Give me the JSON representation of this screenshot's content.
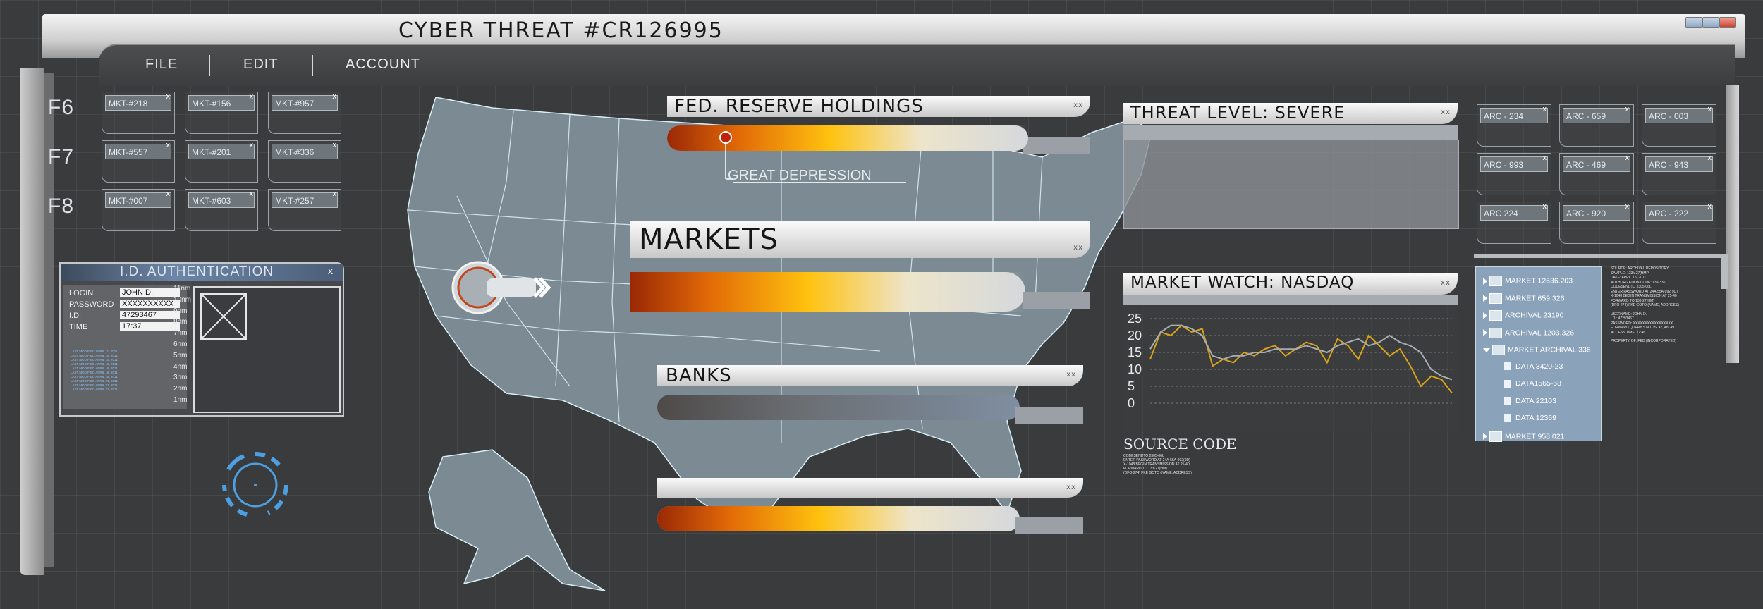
{
  "window": {
    "title": "CYBER THREAT #CR126995"
  },
  "menu": [
    {
      "label": "FILE"
    },
    {
      "label": "EDIT"
    },
    {
      "label": "ACCOUNT"
    }
  ],
  "fkeys": [
    "F6",
    "F7",
    "F8"
  ],
  "mkt_chips": [
    [
      "MKT-#218",
      "MKT-#156",
      "MKT-#957"
    ],
    [
      "MKT-#557",
      "MKT-#201",
      "MKT-#336"
    ],
    [
      "MKT-#007",
      "MKT-#603",
      "MKT-#257"
    ]
  ],
  "arc_chips": [
    [
      "ARC - 234",
      "ARC - 659",
      "ARC - 003"
    ],
    [
      "ARC - 993",
      "ARC - 469",
      "ARC - 943"
    ],
    [
      "ARC 224",
      "ARC - 920",
      "ARC - 222"
    ]
  ],
  "auth": {
    "title": "I.D. AUTHENTICATION",
    "fields": [
      {
        "label": "LOGIN",
        "value": "JOHN D."
      },
      {
        "label": "PASSWORD",
        "value": "XXXXXXXXXX"
      },
      {
        "label": "I.D.",
        "value": "47293467"
      },
      {
        "label": "TIME",
        "value": "17:37"
      }
    ],
    "log_lines": [
      "LAST MODIFIED APRIL 11, 2011",
      "LAST MODIFIED APRIL 14, 2011",
      "LAST MODIFIED APRIL 14, 2011",
      "LAST MODIFIED APRIL 15, 2011",
      "LAST MODIFIED APRIL 16, 2011",
      "LAST MODIFIED APRIL 16, 2011",
      "LAST MODIFIED APRIL 18, 2011",
      "LAST MODIFIED APRIL 21, 2011",
      "LAST MODIFIED APRIL 21, 2011",
      "LAST MODIFIED APRIL 22, 2011"
    ],
    "scale": [
      "11nm",
      "10nm",
      "9nm",
      "8nm",
      "7nm",
      "6nm",
      "5nm",
      "4nm",
      "3nm",
      "2nm",
      "1nm"
    ]
  },
  "fed": {
    "title": "FED. RESERVE HOLDINGS",
    "marker_label": "GREAT DEPRESSION",
    "level": 0.1
  },
  "markets": {
    "title": "MARKETS",
    "level": 0.55
  },
  "banks": {
    "title": "BANKS",
    "level": 1.0
  },
  "unnamed_panel": {
    "title": "",
    "level": 0.55
  },
  "threat": {
    "title": "THREAT LEVEL: SEVERE"
  },
  "market_watch": {
    "title": "MARKET WATCH: NASDAQ"
  },
  "chart_data": {
    "type": "line",
    "title": "MARKET WATCH: NASDAQ",
    "xlabel": "",
    "ylabel": "",
    "ylim": [
      0,
      25
    ],
    "yticks": [
      0,
      5,
      10,
      15,
      20,
      25
    ],
    "grid": true,
    "x": [
      0,
      1,
      2,
      3,
      4,
      5,
      6,
      7,
      8,
      9,
      10,
      11,
      12,
      13,
      14,
      15,
      16,
      17,
      18,
      19,
      20,
      21,
      22,
      23,
      24,
      25,
      26,
      27,
      28,
      29
    ],
    "series": [
      {
        "color": "#d9a21a",
        "values": [
          13,
          21,
          20,
          23,
          21,
          22,
          11,
          13,
          12,
          15,
          14,
          16,
          17,
          14,
          16,
          18,
          17,
          12,
          19,
          17,
          13,
          20,
          17,
          14,
          16,
          11,
          5,
          8,
          7,
          3
        ]
      },
      {
        "color": "#a6aeb4",
        "values": [
          16,
          21,
          23,
          23,
          22,
          20,
          14,
          13,
          14,
          14,
          15,
          15,
          16,
          16,
          16,
          17,
          16,
          15,
          17,
          18,
          19,
          17,
          18,
          20,
          18,
          17,
          15,
          10,
          8,
          7
        ]
      }
    ]
  },
  "tree": [
    {
      "label": "MARKET 12636.203",
      "type": "market",
      "expanded": false
    },
    {
      "label": "MARKET 659.326",
      "type": "market",
      "expanded": false
    },
    {
      "label": "ARCHIVAL 23190",
      "type": "market",
      "expanded": false
    },
    {
      "label": "ARCHIVAL 1203.326",
      "type": "market",
      "expanded": false
    },
    {
      "label": "MARKET ARCHIVAL 336",
      "type": "market",
      "expanded": true
    },
    {
      "label": "DATA 3420-23",
      "type": "data"
    },
    {
      "label": "DATA1565-68",
      "type": "data"
    },
    {
      "label": "DATA 22103",
      "type": "data"
    },
    {
      "label": "DATA 12369",
      "type": "data"
    },
    {
      "label": "MARKET 958.021",
      "type": "market",
      "expanded": false
    }
  ],
  "side_text": [
    "SOURCE: ARCHIVAL REPOSITORY",
    "SAMPLE: 133k-27(HMP",
    "DATE: APRIL 15, 2011",
    "AUTHORIZATION CODE: 139-336",
    "CODESENDTO 2305-06L",
    "ENTER PASSWORD AT 24A-55A-992(9D)",
    "X-1048 BEGIN TRANSMISSION AT 25-40",
    "FORWARD TO 133-27(HM)",
    "(DFO-274) FKE GOTO (NAME, ADDRESS)",
    "",
    "USERNAME: JOHN D.",
    "I.D.: 47293467",
    "PASSWORD: XXXXXXXXXXXXXXXXX",
    "FORWARD QUERY STATUS: 47, 48, 49",
    "ACCESS TIME: 17:46",
    "",
    "PROPERTY OF: FED (INCORPORATED)"
  ],
  "source_code": {
    "title": "SOURCE CODE",
    "lines": [
      "CODESENDTO 2305-06L",
      "ENTER PASSWORD AT 24A-55A-992(9D)",
      "X-1048 BEGIN TRANSMISSION AT 25-40",
      "FORWARD TO 133-27(HM)",
      "(DFO-274) FKE GOTO (NAME, ADDRESS)"
    ]
  }
}
